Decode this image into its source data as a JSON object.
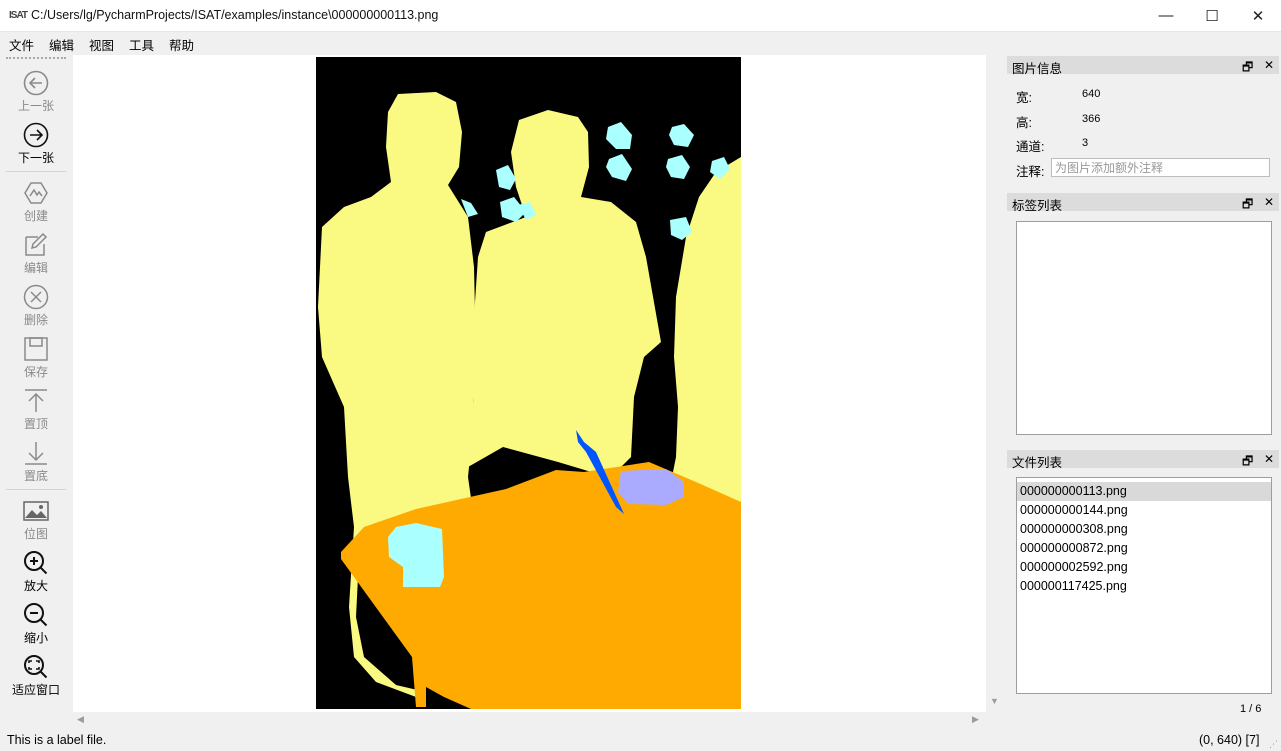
{
  "window": {
    "logo_text": "ISAT",
    "title": "C:/Users/lg/PycharmProjects/ISAT/examples/instance\\000000000113.png",
    "minimize_glyph": "—",
    "maximize_glyph": "☐",
    "close_glyph": "✕"
  },
  "menu": [
    "文件",
    "编辑",
    "视图",
    "工具",
    "帮助"
  ],
  "toolbar": [
    {
      "label": "上一张",
      "icon": "arrow-left-circle-icon",
      "enabled": false
    },
    {
      "label": "下一张",
      "icon": "arrow-right-circle-icon",
      "enabled": true
    },
    {
      "label": "创建",
      "icon": "polygon-create-icon",
      "enabled": false
    },
    {
      "label": "编辑",
      "icon": "edit-icon",
      "enabled": false
    },
    {
      "label": "删除",
      "icon": "delete-circle-icon",
      "enabled": false
    },
    {
      "label": "保存",
      "icon": "save-icon",
      "enabled": false
    },
    {
      "label": "置顶",
      "icon": "to-top-icon",
      "enabled": false
    },
    {
      "label": "置底",
      "icon": "to-bottom-icon",
      "enabled": false
    },
    {
      "label": "位图",
      "icon": "bitmap-icon",
      "enabled": false
    },
    {
      "label": "放大",
      "icon": "zoom-in-icon",
      "enabled": true
    },
    {
      "label": "缩小",
      "icon": "zoom-out-icon",
      "enabled": true
    },
    {
      "label": "适应窗口",
      "icon": "fit-window-icon",
      "enabled": true
    }
  ],
  "panels": {
    "image_info": {
      "title": "图片信息",
      "width_label": "宽:",
      "width_value": "640",
      "height_label": "高:",
      "height_value": "366",
      "channels_label": "通道:",
      "channels_value": "3",
      "note_label": "注释:",
      "note_placeholder": "为图片添加额外注释"
    },
    "labels": {
      "title": "标签列表",
      "items": []
    },
    "files": {
      "title": "文件列表",
      "items": [
        "000000000113.png",
        "000000000144.png",
        "000000000308.png",
        "000000000872.png",
        "000000002592.png",
        "000000117425.png"
      ],
      "selected_index": 0,
      "page_indicator": "1 / 6"
    },
    "float_glyph": "🗗",
    "close_glyph": "✕"
  },
  "status": {
    "message": "This is a label file.",
    "coords": "(0, 640) [7]"
  },
  "colors": {
    "person": "#fafa82",
    "table": "#ffaa00",
    "cup": "#aaffff",
    "bowl": "#aaaaff",
    "knife": "#0055ff",
    "background": "#000000"
  }
}
